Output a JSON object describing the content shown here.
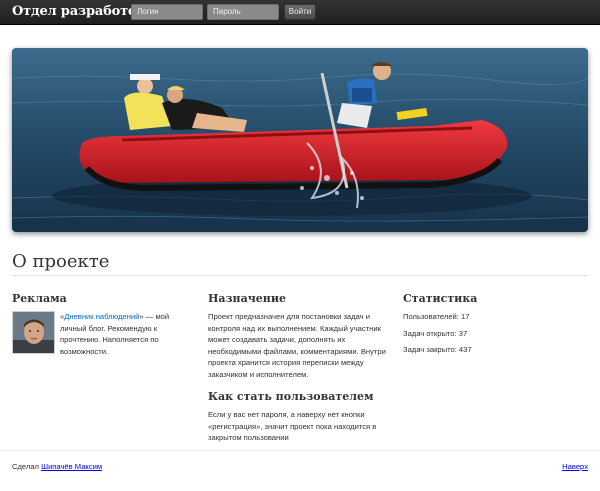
{
  "header": {
    "brand": "Отдел разработок.",
    "login_placeholder": "Логин",
    "password_placeholder": "Пароль",
    "login_button": "Войти"
  },
  "about": {
    "title": "О проекте"
  },
  "ad": {
    "title": "Реклама",
    "quote_open": "«",
    "link_text": "Дневник наблюдений",
    "quote_rest": "» — мой личный блог. Рекомендую к прочтению. Наполняется по возможности."
  },
  "purpose": {
    "title": "Назначение",
    "text": "Проект предназначен для постановки задач и контроля над их выполнением. Каждый участник может создавать задачи, дополнять их необходимыми файлами, комментариями. Внутри проекта хранится история переписки между заказчиком и исполнителем."
  },
  "become_user": {
    "title": "Как стать пользователем",
    "text": "Если у вас нет пароля, а наверху нет кнопки «регистрация», значит проект пока находится в закрытом пользовании"
  },
  "stats": {
    "title": "Статистика",
    "users": "Пользователей: 17",
    "open": "Задач открыто: 37",
    "closed": "Задач закрыто: 437"
  },
  "footer": {
    "made_by": "Сделал",
    "author": "Шипачёв Максим",
    "to_top": "Наверх"
  },
  "colors": {
    "link": "#0069d6",
    "boat": "#d8222a",
    "topbar": "#222222"
  }
}
